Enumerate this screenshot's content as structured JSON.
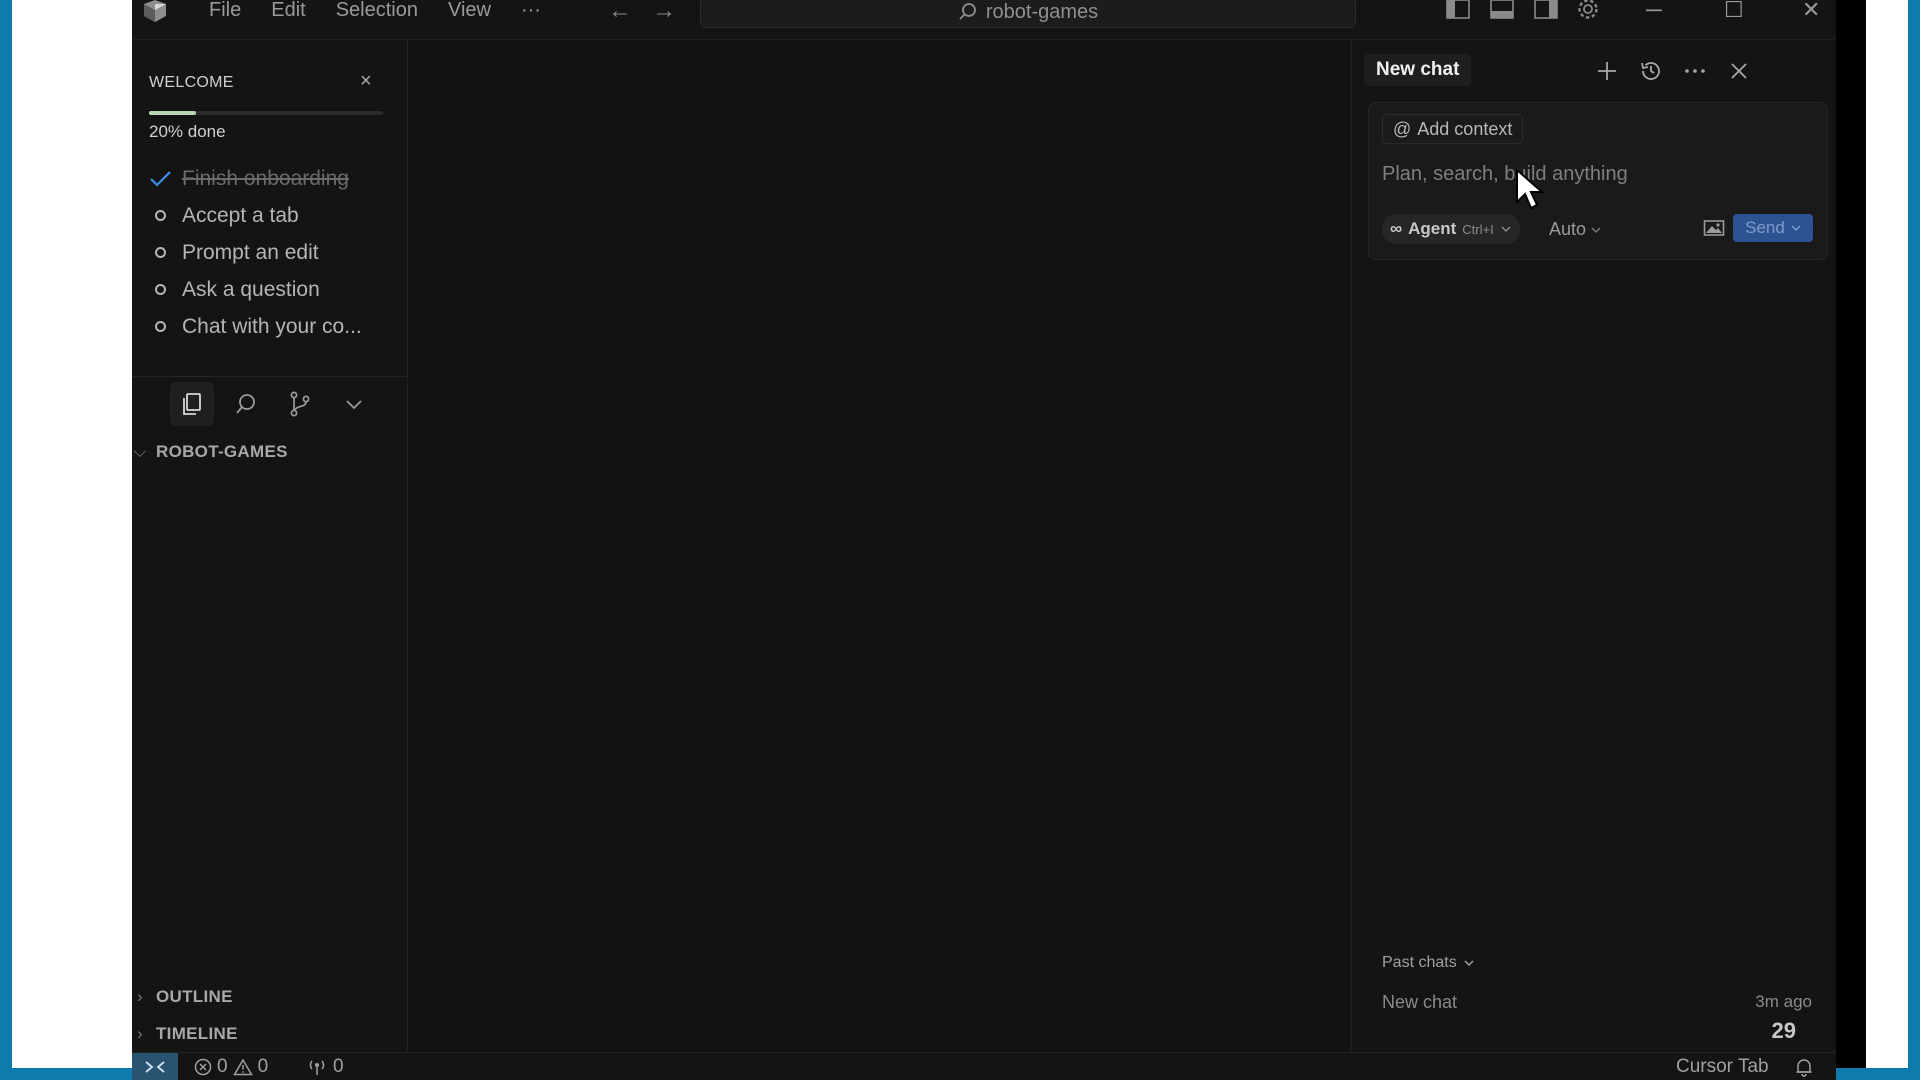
{
  "titlebar": {
    "menu": [
      "File",
      "Edit",
      "Selection",
      "View",
      "···"
    ],
    "back_arrow": "←",
    "forward_arrow": "→",
    "search_text": "robot-games",
    "window_buttons": {
      "minimize": "─",
      "maximize": "☐",
      "close": "✕"
    }
  },
  "welcome": {
    "title": "WELCOME",
    "close": "×",
    "progress_percent": 20,
    "progress_label": "20% done",
    "items": [
      {
        "label": "Finish onboarding",
        "done": true
      },
      {
        "label": "Accept a tab",
        "done": false
      },
      {
        "label": "Prompt an edit",
        "done": false
      },
      {
        "label": "Ask a question",
        "done": false
      },
      {
        "label": "Chat with your co...",
        "done": false
      }
    ]
  },
  "explorer": {
    "project": "ROBOT-GAMES",
    "outline": "OUTLINE",
    "timeline": "TIMELINE"
  },
  "chat": {
    "tab": "New chat",
    "add_context": "Add context",
    "placeholder": "Plan, search, build anything",
    "agent_label": "Agent",
    "agent_shortcut": "Ctrl+I",
    "model": "Auto",
    "send": "Send",
    "past_chats_label": "Past chats",
    "past_chats": [
      {
        "title": "New chat",
        "time": "3m ago"
      }
    ],
    "counter": "29"
  },
  "statusbar": {
    "errors": "0",
    "warnings": "0",
    "ports": "0",
    "cursor_tab": "Cursor Tab"
  },
  "colors": {
    "frame": "#0d7bab",
    "background": "#141414",
    "progress": "#b9d6b5",
    "check": "#3b8eea",
    "send": "#2d5390"
  }
}
